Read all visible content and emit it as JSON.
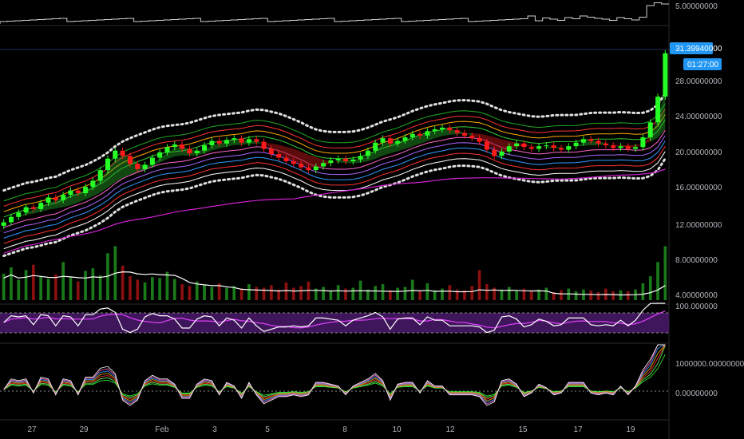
{
  "chart_data": {
    "type": "candlestick",
    "x_ticks": [
      "27",
      "29",
      "Feb",
      "3",
      "5",
      "8",
      "10",
      "12",
      "15",
      "17",
      "19"
    ],
    "last_price_label": "31.39940000",
    "countdown_label": "01:27:00",
    "colors": {
      "up": "#26ff26",
      "down": "#ff1a1a",
      "accent": "#2196f3",
      "rsi_band": "#4a1a6b",
      "rsi_line": "#ffffff",
      "rsi_signal": "#e040fb",
      "long_ma": "#d020d0"
    },
    "panes": [
      {
        "name": "top-indicator",
        "y_ticks": [
          "5.00000000"
        ]
      },
      {
        "name": "price",
        "y_ticks": [
          "28.00000000",
          "24.00000000",
          "20.00000000",
          "16.00000000",
          "12.00000000",
          "8.00000000",
          "4.00000000"
        ],
        "ylim": [
          3.5,
          34
        ],
        "close_series": [
          12.3,
          12.9,
          13.4,
          14.0,
          13.8,
          14.5,
          15.1,
          14.8,
          15.4,
          15.9,
          15.6,
          16.3,
          17.0,
          18.2,
          19.5,
          20.4,
          19.8,
          18.9,
          18.3,
          18.8,
          19.6,
          20.2,
          20.8,
          21.1,
          20.6,
          20.1,
          20.4,
          21.0,
          21.5,
          21.2,
          21.6,
          21.8,
          21.3,
          21.7,
          21.4,
          20.6,
          20.0,
          19.6,
          19.2,
          18.9,
          18.5,
          18.2,
          18.6,
          19.0,
          19.3,
          19.5,
          19.2,
          19.4,
          19.8,
          20.4,
          21.3,
          21.8,
          21.2,
          21.5,
          21.9,
          22.3,
          22.1,
          22.6,
          22.8,
          23.0,
          22.7,
          22.4,
          22.1,
          21.8,
          21.4,
          20.5,
          19.8,
          20.3,
          20.9,
          21.2,
          20.8,
          20.6,
          20.9,
          21.0,
          20.7,
          20.5,
          20.9,
          21.3,
          21.7,
          21.5,
          21.2,
          21.0,
          20.7,
          20.9,
          20.6,
          20.8,
          21.9,
          23.6,
          26.5,
          31.4
        ],
        "volume_series": [
          6.5,
          7.2,
          5.8,
          6.9,
          7.5,
          6.2,
          5.9,
          6.4,
          7.8,
          6.1,
          5.6,
          6.8,
          7.1,
          6.3,
          8.8,
          9.6,
          7.4,
          6.2,
          5.8,
          5.5,
          6.1,
          6.0,
          6.7,
          5.9,
          5.3,
          5.1,
          5.6,
          5.2,
          5.0,
          5.4,
          4.9,
          5.1,
          4.8,
          5.3,
          5.0,
          4.9,
          5.2,
          4.7,
          5.5,
          4.9,
          5.1,
          5.6,
          4.8,
          5.0,
          4.6,
          5.2,
          4.8,
          4.9,
          5.7,
          4.7,
          5.1,
          5.3,
          4.6,
          4.9,
          5.0,
          5.8,
          4.5,
          5.4,
          4.6,
          4.8,
          5.2,
          4.7,
          4.6,
          5.1,
          6.9,
          5.3,
          4.9,
          4.7,
          5.0,
          4.6,
          4.8,
          4.5,
          4.7,
          4.9,
          4.4,
          4.6,
          4.8,
          4.5,
          4.7,
          4.6,
          4.4,
          4.8,
          4.5,
          4.6,
          4.5,
          4.7,
          5.4,
          6.2,
          7.8,
          9.6
        ]
      },
      {
        "name": "rsi",
        "y_ticks": [
          "100.000000"
        ]
      },
      {
        "name": "oscillator",
        "y_ticks": [
          "1000000.00000000",
          "0.00000000"
        ]
      }
    ]
  }
}
